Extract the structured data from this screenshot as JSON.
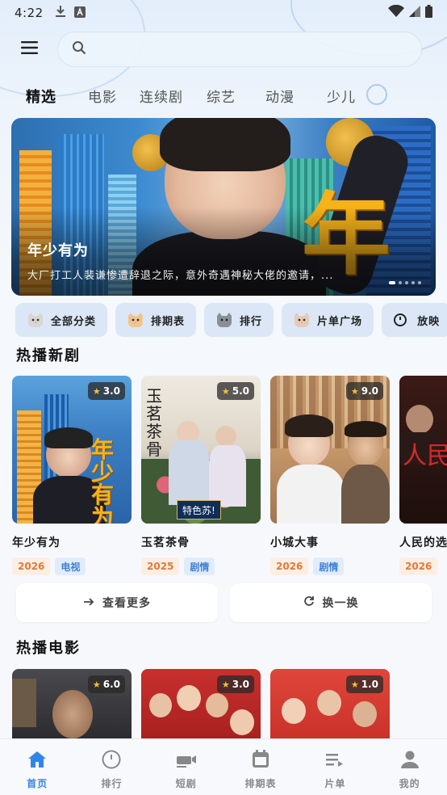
{
  "status_bar": {
    "time": "4:22",
    "left_icons": [
      "download-icon",
      "keyboard-a-icon"
    ],
    "right_icons": [
      "wifi-icon",
      "signal-icon",
      "battery-icon"
    ]
  },
  "search": {
    "placeholder": "",
    "value": ""
  },
  "tabs": [
    {
      "label": "精选",
      "active": true
    },
    {
      "label": "电影",
      "active": false
    },
    {
      "label": "连续剧",
      "active": false
    },
    {
      "label": "综艺",
      "active": false
    },
    {
      "label": "动漫",
      "active": false
    },
    {
      "label": "少儿",
      "active": false
    }
  ],
  "hero": {
    "title": "年少有为",
    "description": "大厂打工人裴谦惨遭辞退之际，意外奇遇神秘大佬的邀请，...",
    "poster_text": "年",
    "pages": 5,
    "current_page": 1
  },
  "chips": [
    {
      "label": "全部分类",
      "icon": "cat-icon"
    },
    {
      "label": "排期表",
      "icon": "cat-icon"
    },
    {
      "label": "排行",
      "icon": "cat-icon"
    },
    {
      "label": "片单广场",
      "icon": "cat-icon"
    },
    {
      "label": "放映",
      "icon": "clock-icon"
    }
  ],
  "sections": {
    "hot_series": {
      "title": "热播新剧",
      "items": [
        {
          "title": "年少有为",
          "rating": "3.0",
          "year": "2026",
          "genre": "电视",
          "poster_text": "年少有为"
        },
        {
          "title": "玉茗茶骨",
          "rating": "5.0",
          "year": "2025",
          "genre": "剧情",
          "poster_text": "玉茗茶骨",
          "poster_sub": "特色苏!"
        },
        {
          "title": "小城大事",
          "rating": "9.0",
          "year": "2026",
          "genre": "剧情",
          "poster_text": ""
        },
        {
          "title": "人民的选",
          "rating": "",
          "year": "2026",
          "genre": "",
          "poster_text": "人民"
        }
      ]
    },
    "hot_movies": {
      "title": "热播电影",
      "items": [
        {
          "rating": "6.0"
        },
        {
          "rating": "3.0"
        },
        {
          "rating": "1.0"
        }
      ]
    }
  },
  "actions": {
    "more_label": "查看更多",
    "refresh_label": "换一换"
  },
  "bottom_nav": [
    {
      "label": "首页",
      "icon": "home-icon",
      "active": true
    },
    {
      "label": "排行",
      "icon": "ranking-icon",
      "active": false
    },
    {
      "label": "短剧",
      "icon": "short-drama-icon",
      "active": false
    },
    {
      "label": "排期表",
      "icon": "calendar-icon",
      "active": false
    },
    {
      "label": "片单",
      "icon": "playlist-icon",
      "active": false
    },
    {
      "label": "我的",
      "icon": "profile-icon",
      "active": false
    }
  ],
  "colors": {
    "accent": "#2f86e8",
    "year_tag_text": "#e07a3a",
    "year_tag_bg": "#fdeee3",
    "genre_tag_text": "#3d7fd6",
    "genre_tag_bg": "#e1ecfb",
    "rating_star": "#f7c12d"
  }
}
